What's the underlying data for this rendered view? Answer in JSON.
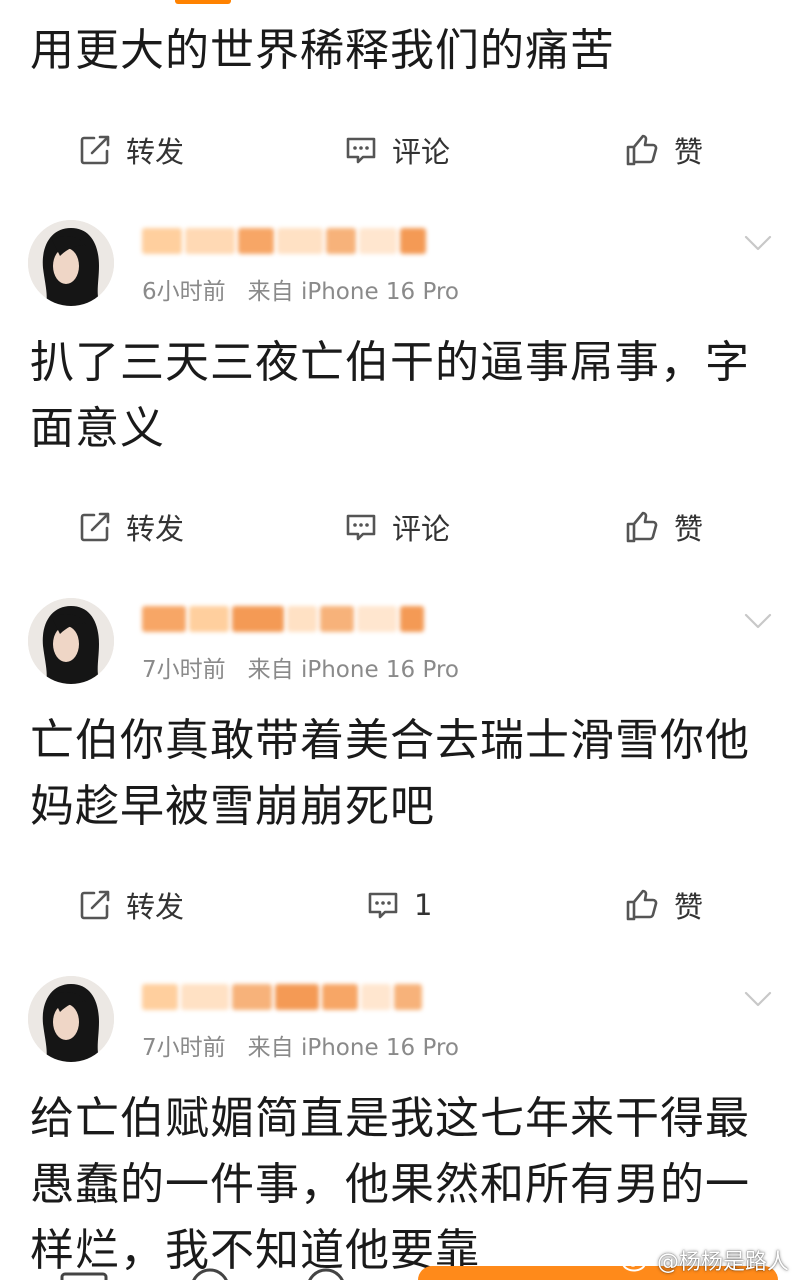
{
  "colors": {
    "accent": "#ff8200",
    "meta_text": "#8a8a8a",
    "body_text": "#1a1a1a",
    "icon_stroke": "#555555"
  },
  "actions": {
    "repost_label": "转发",
    "comment_label": "评论",
    "like_label": "赞"
  },
  "posts": [
    {
      "text": "用更大的世界稀释我们的痛苦",
      "comment_label": "评论"
    },
    {
      "time": "6小时前",
      "source": "来自 iPhone 16 Pro",
      "text": "扒了三天三夜亡伯干的逼事屌事，字面意义",
      "comment_label": "评论"
    },
    {
      "time": "7小时前",
      "source": "来自 iPhone 16 Pro",
      "text": "亡伯你真敢带着美合去瑞士滑雪你他妈趁早被雪崩崩死吧",
      "comment_count": "1"
    },
    {
      "time": "7小时前",
      "source": "来自 iPhone 16 Pro",
      "text": "给亡伯赋媚简直是我这七年来干得最愚蠢的一件事，他果然和所有男的一样烂，我不知道他要靠"
    }
  ],
  "watermark": "@杨杨是路人"
}
